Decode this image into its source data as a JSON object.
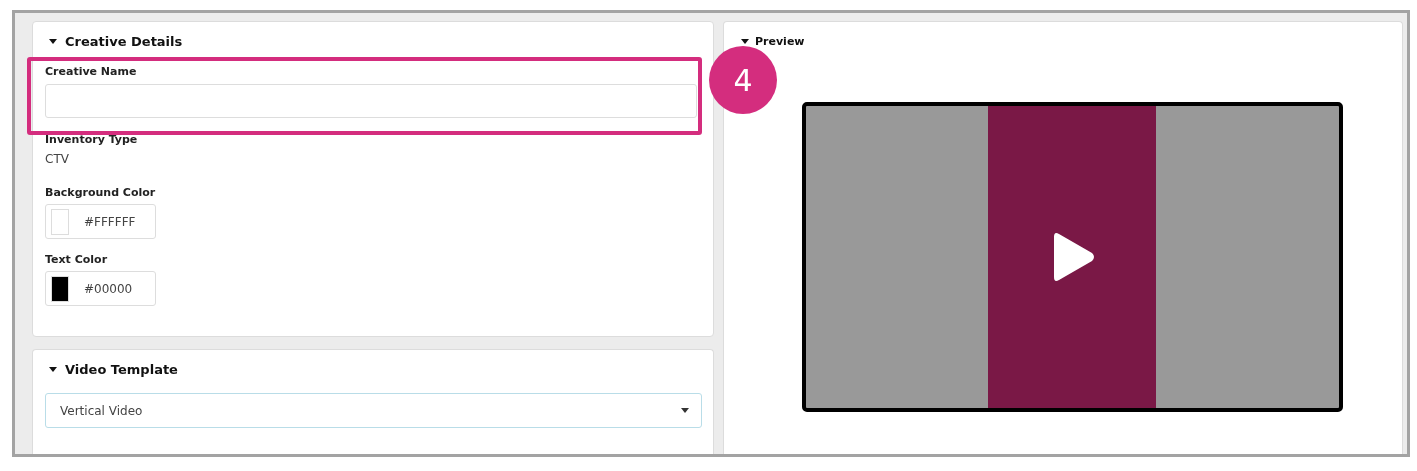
{
  "annotation": {
    "number": "4"
  },
  "creative_details": {
    "title": "Creative Details",
    "expanded": true,
    "fields": [
      {
        "kind": "text",
        "label": "Creative Name"
      },
      {
        "kind": "static",
        "label": "Inventory Type",
        "value": "CTV"
      },
      {
        "kind": "color",
        "label": "Background Color",
        "value": "#FFFFFF",
        "color": "#ffffff"
      },
      {
        "kind": "color",
        "label": "Text Color",
        "value": "#00000",
        "color": "#000000"
      }
    ]
  },
  "video_template": {
    "title": "Video Template",
    "expanded": true,
    "select": {
      "value": "Vertical Video"
    }
  },
  "preview": {
    "title": "Preview",
    "expanded": true
  }
}
